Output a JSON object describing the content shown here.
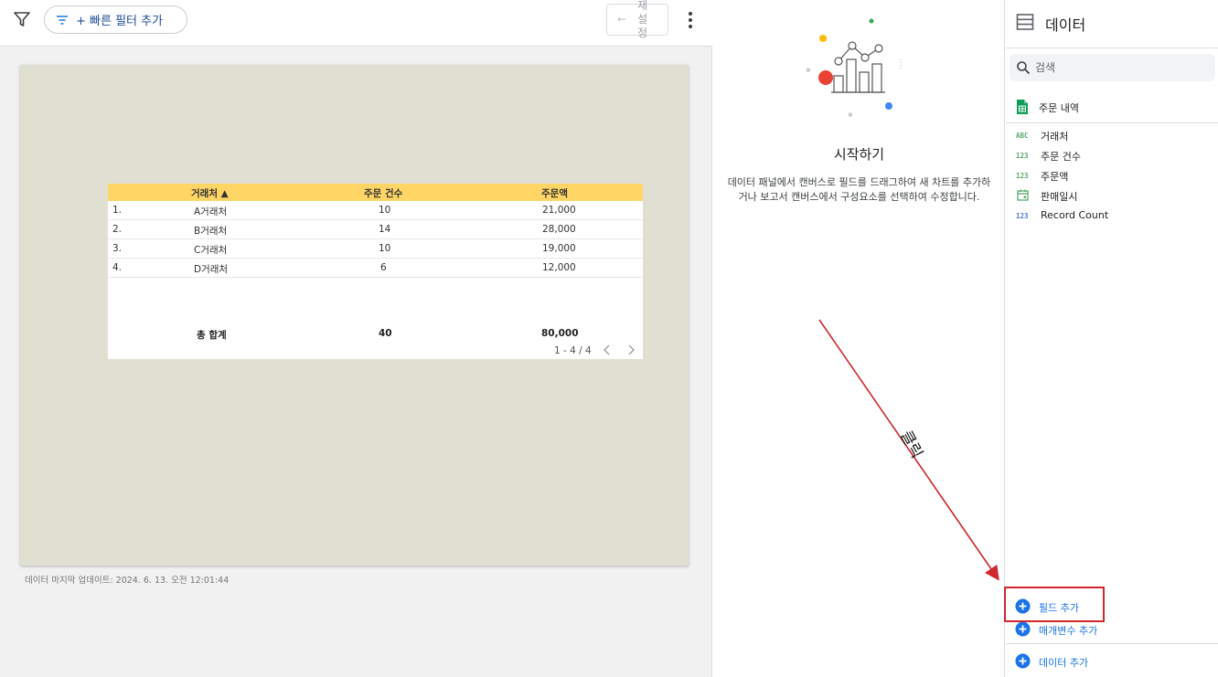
{
  "toolbar": {
    "filter_icon": "filter-funnel-icon",
    "quick_filter_label": "+ 빠른 필터 추가",
    "reset_label": "재설정"
  },
  "report": {
    "last_updated": "데이터 마지막 업데이트: 2024. 6. 13. 오전 12:01:44",
    "table": {
      "headers": [
        "거래처 ▲",
        "주문 건수",
        "주문액"
      ],
      "rows": [
        {
          "num": "1.",
          "client": "A거래처",
          "orders": "10",
          "amount": "21,000"
        },
        {
          "num": "2.",
          "client": "B거래처",
          "orders": "14",
          "amount": "28,000"
        },
        {
          "num": "3.",
          "client": "C거래처",
          "orders": "10",
          "amount": "19,000"
        },
        {
          "num": "4.",
          "client": "D거래처",
          "orders": "6",
          "amount": "12,000"
        }
      ],
      "total": {
        "label": "총 합계",
        "orders": "40",
        "amount": "80,000"
      },
      "pagination": "1 - 4 / 4",
      "header_color": "#ffd666"
    }
  },
  "start_panel": {
    "title": "시작하기",
    "description": "데이터 패널에서 캔버스로 필드를 드래그하여 새 차트를 추가하거나 보고서 캔버스에서 구성요소를 선택하여 수정합니다."
  },
  "data_panel": {
    "title": "데이터",
    "search_placeholder": "검색",
    "source_name": "주문 내역",
    "fields": [
      {
        "type": "ABC",
        "name": "거래처"
      },
      {
        "type": "123",
        "name": "주문 건수"
      },
      {
        "type": "123",
        "name": "주문액"
      },
      {
        "type": "calendar",
        "name": "판매일시"
      },
      {
        "type": "123",
        "name": "Record Count"
      }
    ],
    "add_field_label": "필드 추가",
    "add_parameter_label": "매개변수 추가",
    "add_data_label": "데이터 추가"
  },
  "annotation": {
    "click_label": "클릭",
    "color": "#d0262e"
  }
}
